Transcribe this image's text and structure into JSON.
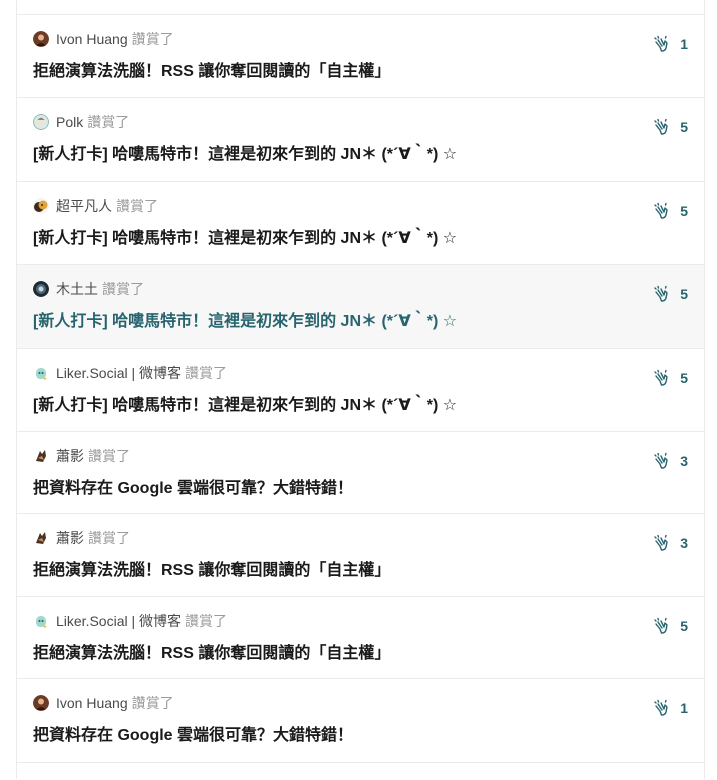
{
  "colors": {
    "accent": "#28646e",
    "user_text": "#4a4a4a",
    "muted": "#9b9b9b",
    "title_text": "#1a1a1a",
    "hover_bg": "#f7f7f7",
    "divider": "#ebebeb"
  },
  "icons": {
    "like_count": "clap-icon"
  },
  "activities": [
    {
      "user": "Ivon Huang",
      "action": "讚賞了",
      "title": "拒絕演算法洗腦！RSS 讓你奪回閱讀的「自主權」",
      "count": "1",
      "avatar": "avatar-ivon-huang"
    },
    {
      "user": "Polk",
      "action": "讚賞了",
      "title": "[新人打卡] 哈嘍馬特市！這裡是初來乍到的 JN＊ (*´∀｀*) ☆",
      "count": "5",
      "avatar": "avatar-polk"
    },
    {
      "user": "超平凡人",
      "action": "讚賞了",
      "title": "[新人打卡] 哈嘍馬特市！這裡是初來乍到的 JN＊ (*´∀｀*) ☆",
      "count": "5",
      "avatar": "avatar-chaopingfanren"
    },
    {
      "user": "木土土",
      "action": "讚賞了",
      "title": "[新人打卡] 哈嘍馬特市！這裡是初來乍到的 JN＊ (*´∀｀*) ☆",
      "count": "5",
      "avatar": "avatar-mututu"
    },
    {
      "user": "Liker.Social | 微博客",
      "action": "讚賞了",
      "title": "[新人打卡] 哈嘍馬特市！這裡是初來乍到的 JN＊ (*´∀｀*) ☆",
      "count": "5",
      "avatar": "avatar-liker-social"
    },
    {
      "user": "蕭影",
      "action": "讚賞了",
      "title": "把資料存在 Google 雲端很可靠？大錯特錯！",
      "count": "3",
      "avatar": "avatar-xiaoying"
    },
    {
      "user": "蕭影",
      "action": "讚賞了",
      "title": "拒絕演算法洗腦！RSS 讓你奪回閱讀的「自主權」",
      "count": "3",
      "avatar": "avatar-xiaoying"
    },
    {
      "user": "Liker.Social | 微博客",
      "action": "讚賞了",
      "title": "拒絕演算法洗腦！RSS 讓你奪回閱讀的「自主權」",
      "count": "5",
      "avatar": "avatar-liker-social"
    },
    {
      "user": "Ivon Huang",
      "action": "讚賞了",
      "title": "把資料存在 Google 雲端很可靠？大錯特錯！",
      "count": "1",
      "avatar": "avatar-ivon-huang"
    }
  ]
}
